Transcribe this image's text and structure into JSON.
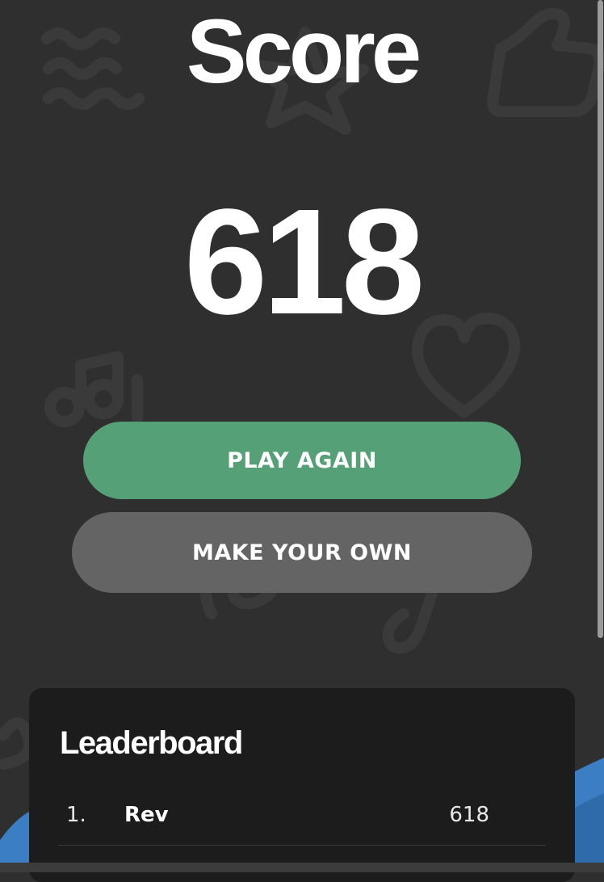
{
  "header": {
    "title": "Score"
  },
  "result": {
    "score": "618"
  },
  "actions": {
    "play_again_label": "PLAY AGAIN",
    "make_your_own_label": "MAKE YOUR OWN"
  },
  "leaderboard": {
    "title": "Leaderboard",
    "entries": [
      {
        "rank": "1.",
        "name": "Rev",
        "score": "618"
      }
    ]
  },
  "colors": {
    "background": "#2f2f2f",
    "play_button": "#56a077",
    "secondary_button": "#646464",
    "panel": "#1c1c1c",
    "wave": "#3b7ec4"
  },
  "icons": {
    "background_doodles": [
      "squiggle-lines-icon",
      "star-icon",
      "thumbs-up-icon",
      "music-note-icon",
      "heart-icon",
      "swirl-icon"
    ]
  }
}
